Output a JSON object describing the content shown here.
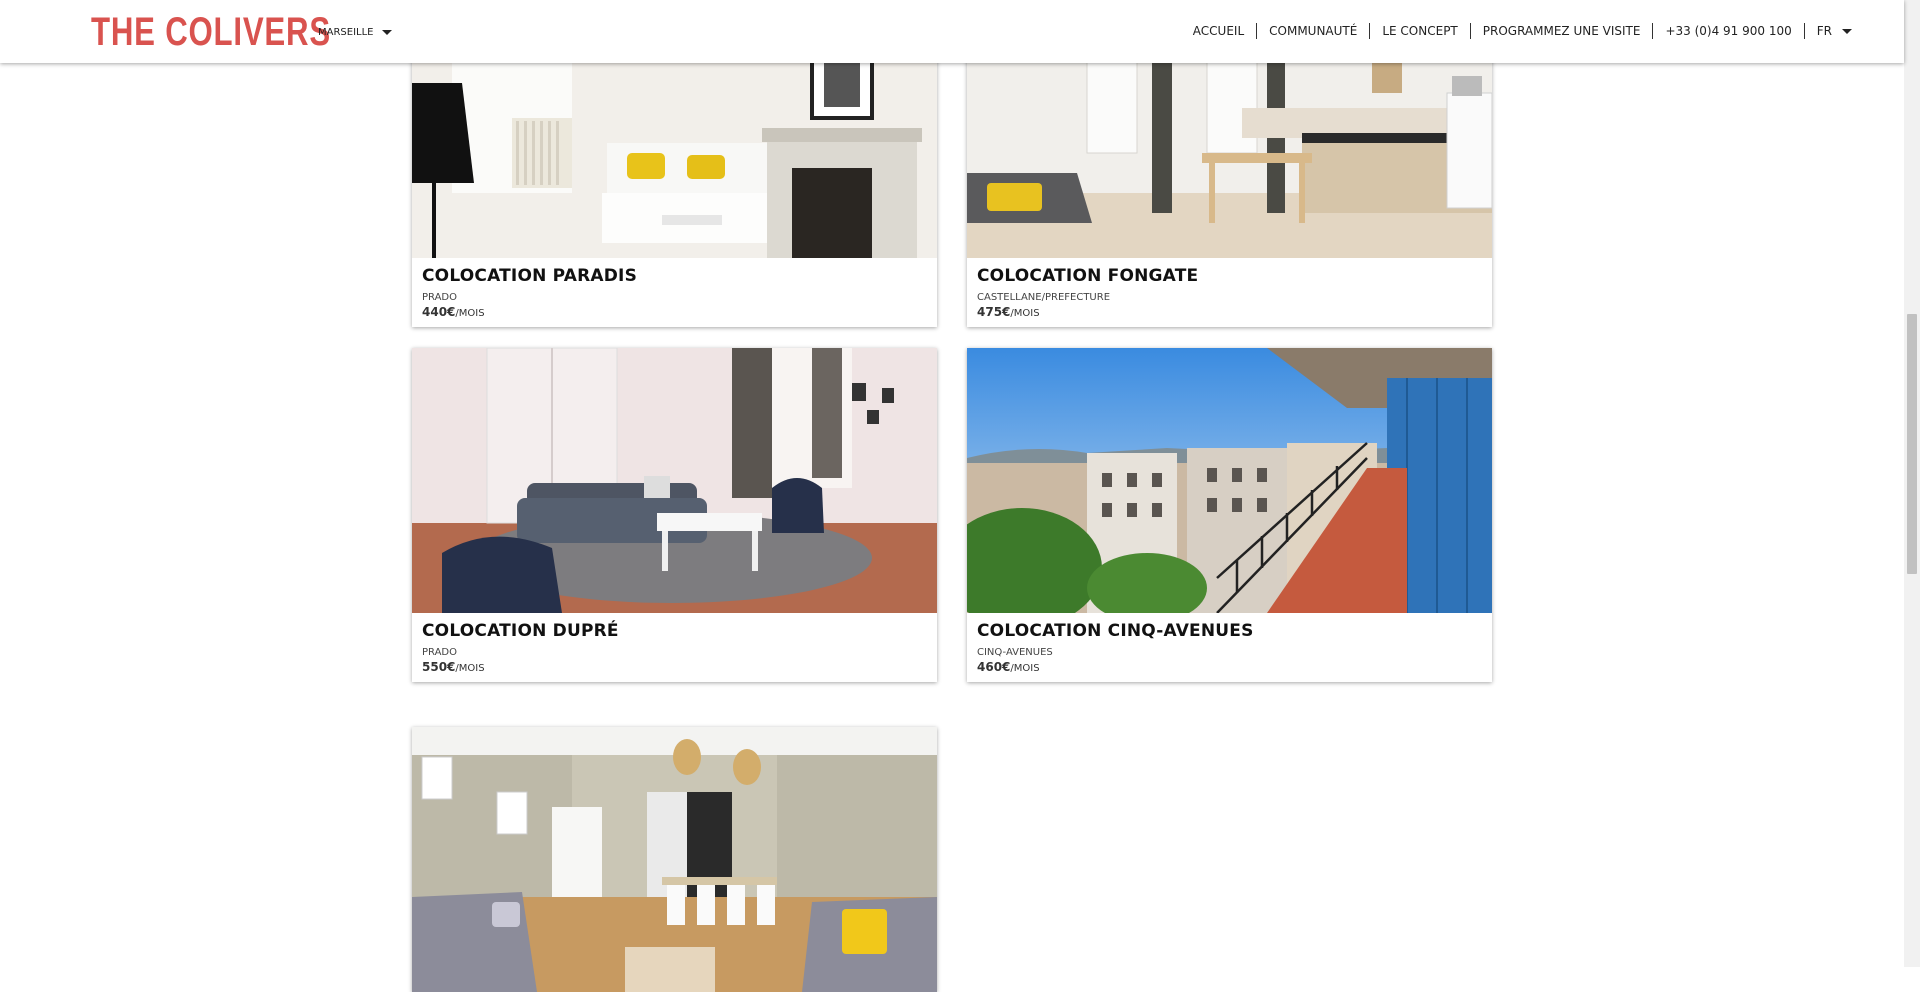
{
  "header": {
    "logo": "THE COLIVERS",
    "city": "MARSEILLE",
    "nav": [
      "ACCUEIL",
      "COMMUNAUTÉ",
      "LE CONCEPT",
      "PROGRAMMEZ UNE VISITE",
      "+33 (0)4 91 900 100"
    ],
    "lang": "FR"
  },
  "listings": [
    {
      "title": "COLOCATION PARADIS",
      "area": "PRADO",
      "price": "440€",
      "unit": "/MOIS"
    },
    {
      "title": "COLOCATION FONGATE",
      "area": "CASTELLANE/PREFECTURE",
      "price": "475€",
      "unit": "/MOIS"
    },
    {
      "title": "COLOCATION DUPRÉ",
      "area": "PRADO",
      "price": "550€",
      "unit": "/MOIS"
    },
    {
      "title": "COLOCATION CINQ-AVENUES",
      "area": "CINQ-AVENUES",
      "price": "460€",
      "unit": "/MOIS"
    }
  ],
  "colors": {
    "brand": "#d9534f"
  }
}
